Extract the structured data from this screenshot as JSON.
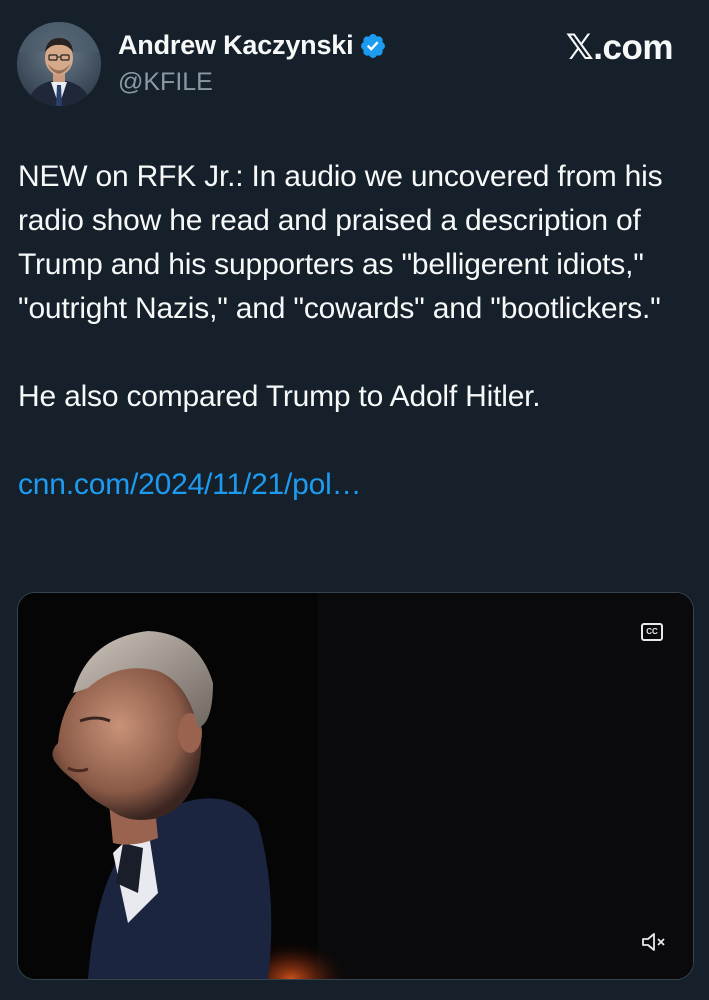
{
  "author": {
    "name": "Andrew Kaczynski",
    "handle": "@KFILE",
    "verified": true,
    "avatar_icon": "profile-photo"
  },
  "brand": {
    "label": "𝕏.com"
  },
  "tweet": {
    "paragraph1": "NEW on RFK Jr.: In audio we uncovered from his radio show he read and praised a description of Trump and his supporters as \"belligerent idiots,\" \"outright Nazis,\" and \"cowards\" and \"bootlickers.\"",
    "paragraph2": "He also compared Trump to Adolf Hitler.",
    "link": "cnn.com/2024/11/21/pol…"
  },
  "media": {
    "type": "video",
    "captions_label": "CC",
    "captions_icon": "closed-captions-icon",
    "mute_icon": "volume-muted-icon"
  },
  "colors": {
    "background": "#15202b",
    "text": "#f7f9f9",
    "secondary_text": "#8b98a5",
    "link": "#1d9bf0",
    "verified_badge": "#1d9bf0"
  }
}
